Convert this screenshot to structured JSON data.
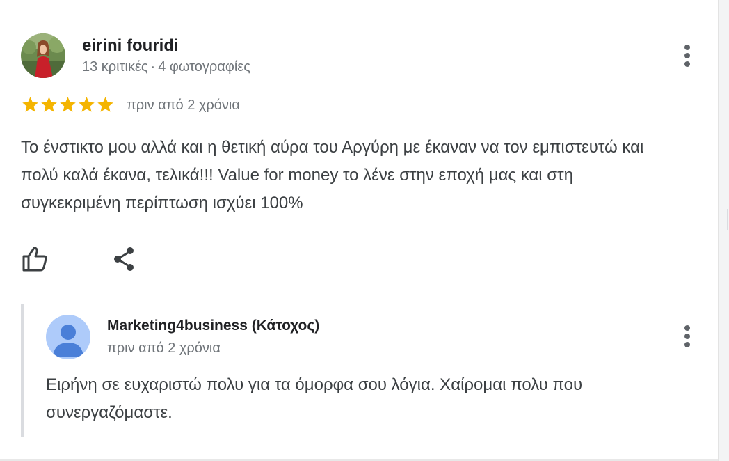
{
  "review": {
    "author": "eirini fouridi",
    "reviews_count": "13 κριτικές",
    "separator": "·",
    "photos_count": "4 φωτογραφίες",
    "rating": 5,
    "rating_max": 5,
    "time": "πριν από 2 χρόνια",
    "text": "Το ένστικτο μου αλλά και η θετική αύρα του Αργύρη με έκαναν να τον εμπιστευτώ και πολύ καλά έκανα, τελικά!!! Value for money το λένε στην εποχή μας και στη συγκεκριμένη περίπτωση ισχύει 100%"
  },
  "actions": {
    "like_icon": "thumbs-up-icon",
    "share_icon": "share-icon",
    "more_icon": "more-vert-icon"
  },
  "reply": {
    "author": "Marketing4business (Κάτοχος)",
    "time": "πριν από 2 χρόνια",
    "text": "Ειρήνη σε ευχαριστώ πολυ για τα όμορφα σου λόγια. Χαίρομαι πολυ που συνεργαζόμαστε."
  },
  "colors": {
    "star": "#f4b400",
    "secondary_text": "#70757a",
    "icon": "#5f6368",
    "owner_avatar_bg": "#aecbfa",
    "owner_avatar_fg": "#4a7fd8"
  }
}
